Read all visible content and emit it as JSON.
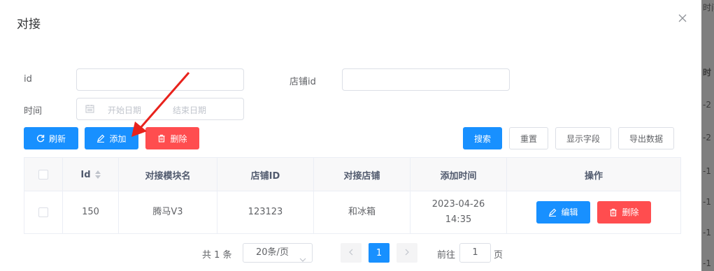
{
  "dialog": {
    "title": "对接"
  },
  "background": {
    "texts": [
      "时间",
      "时",
      "-2",
      "-2",
      "-1",
      "-1",
      "-1",
      "-1"
    ]
  },
  "filters": {
    "id_label": "id",
    "id_value": "",
    "shop_id_label": "店铺id",
    "shop_id_value": "",
    "time_label": "时间",
    "start_placeholder": "开始日期",
    "end_placeholder": "结束日期"
  },
  "toolbar": {
    "refresh": "刷新",
    "add": "添加",
    "delete": "删除",
    "search": "搜索",
    "reset": "重置",
    "show_fields": "显示字段",
    "export": "导出数据"
  },
  "table": {
    "columns": [
      "Id",
      "对接模块名",
      "店铺ID",
      "对接店铺",
      "添加时间",
      "操作"
    ],
    "rows": [
      {
        "id": "150",
        "module": "腾马V3",
        "shop_id": "123123",
        "shop": "和冰箱",
        "added_time": "2023-04-26 14:35",
        "edit": "编辑",
        "delete": "删除"
      }
    ]
  },
  "pagination": {
    "total": "共 1 条",
    "page_size": "20条/页",
    "current": "1",
    "goto_prefix": "前往",
    "goto_value": "1",
    "goto_suffix": "页"
  },
  "colors": {
    "primary": "#1890ff",
    "danger": "#ff4d4f",
    "annotation_arrow": "#e8221c"
  },
  "icons": [
    "close-icon",
    "calendar-icon",
    "refresh-icon",
    "edit-icon",
    "trash-icon",
    "sort-icon",
    "chevron-down-icon",
    "chevron-left-icon",
    "chevron-right-icon",
    "red-arrow-annotation"
  ]
}
